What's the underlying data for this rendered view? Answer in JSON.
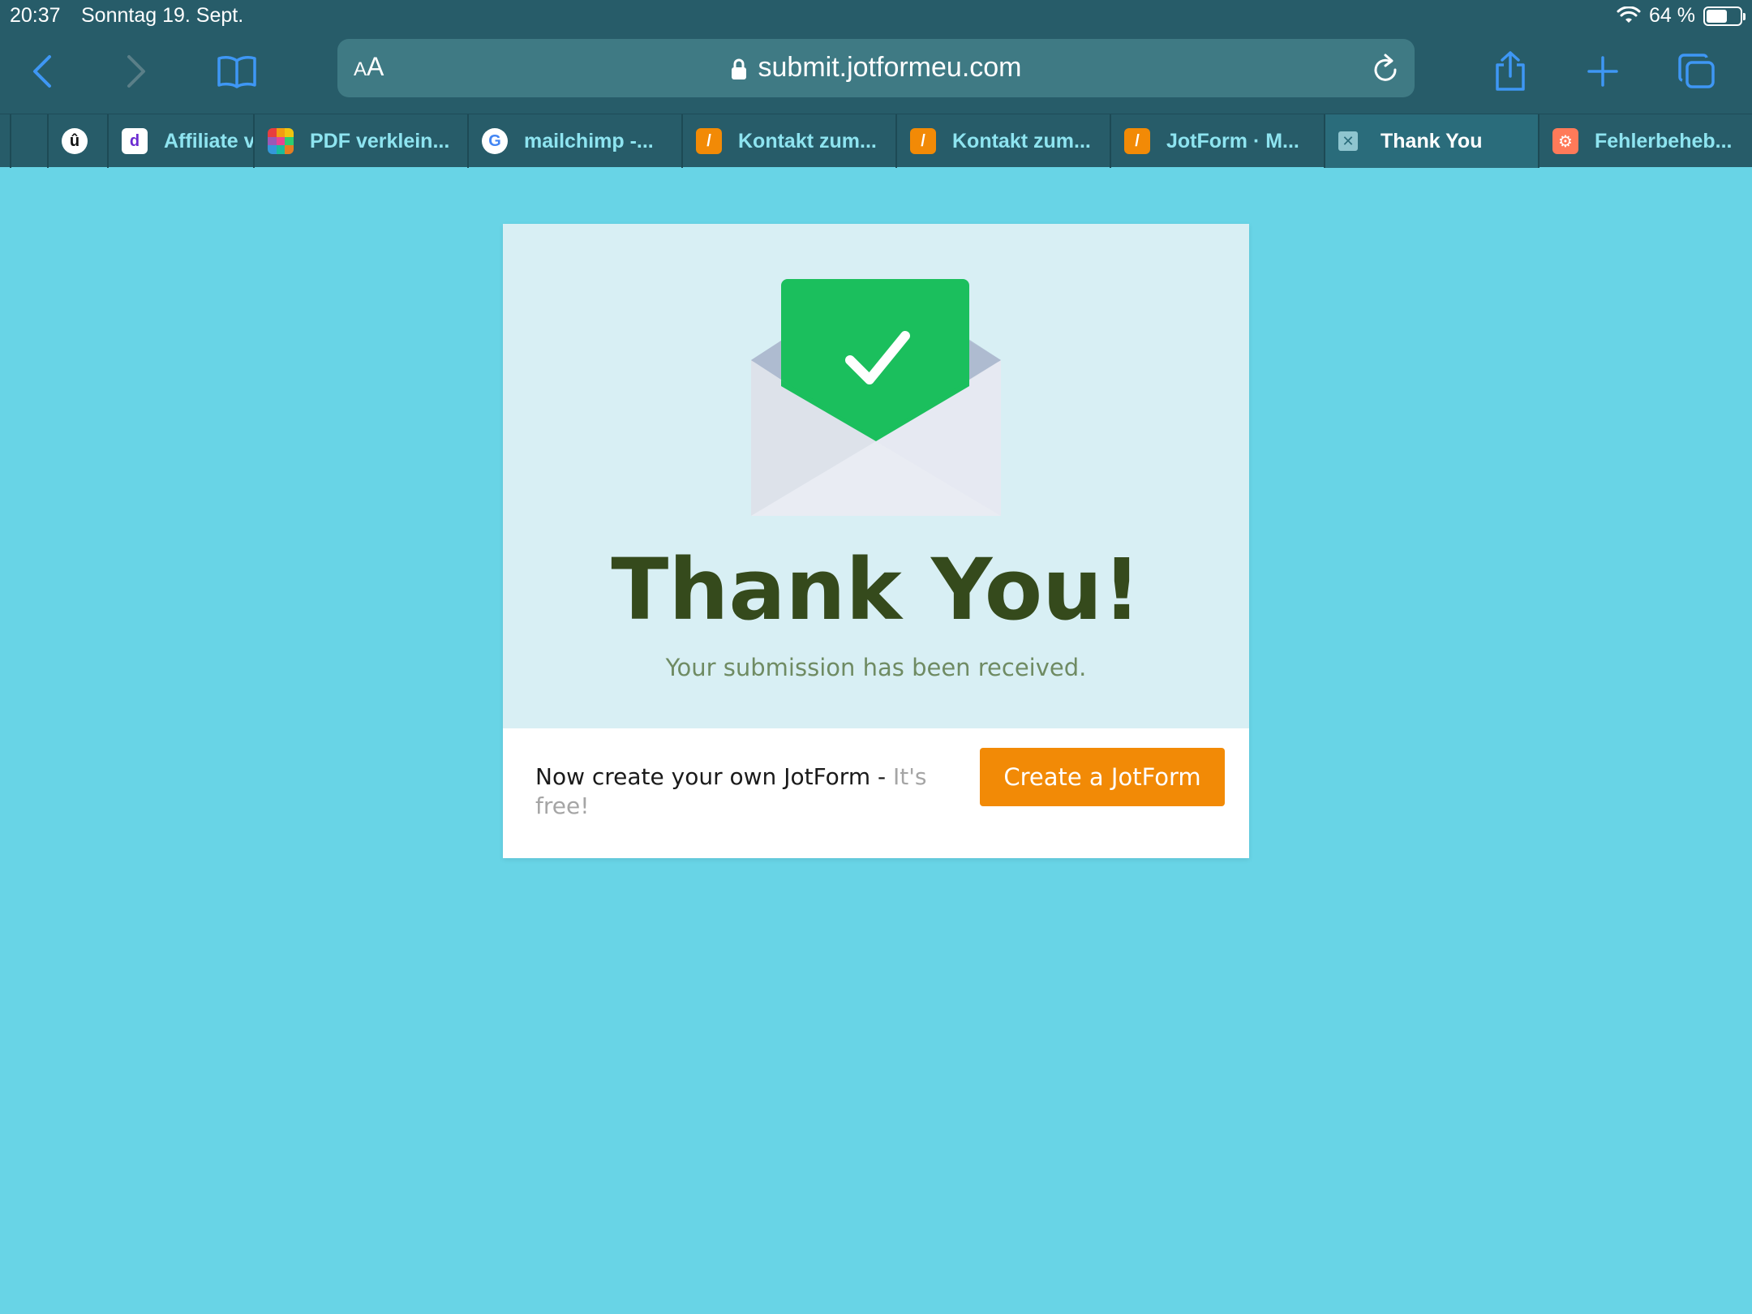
{
  "status_bar": {
    "time": "20:37",
    "date": "Sonntag 19. Sept.",
    "battery": "64 %",
    "battery_level": 0.64
  },
  "toolbar": {
    "text_size_label": "AA",
    "url": "submit.jotformeu.com"
  },
  "tabs": [
    {
      "label": "",
      "favicon": "udemy-icon"
    },
    {
      "label": "Affiliate v",
      "favicon": "d-logo-icon"
    },
    {
      "label": "PDF verklein...",
      "favicon": "ilovepdf-icon"
    },
    {
      "label": "mailchimp -...",
      "favicon": "google-icon"
    },
    {
      "label": "Kontakt zum...",
      "favicon": "jotform-icon"
    },
    {
      "label": "Kontakt zum...",
      "favicon": "jotform-icon"
    },
    {
      "label": "JotForm · M...",
      "favicon": "jotform-icon"
    },
    {
      "label": "Thank You",
      "favicon": "close-icon",
      "active": true
    },
    {
      "label": "Fehlerbeheb...",
      "favicon": "hubspot-icon"
    }
  ],
  "page": {
    "title": "Thank You!",
    "subtitle": "Your submission has been received.",
    "promo_text": "Now create your own JotForm - ",
    "promo_free": "It's free!",
    "cta_label": "Create a JotForm"
  },
  "colors": {
    "background": "#68d4e6",
    "card_top": "#d8eff4",
    "title": "#354a1c",
    "cta": "#f28a06",
    "check_green": "#1bbf5d"
  }
}
